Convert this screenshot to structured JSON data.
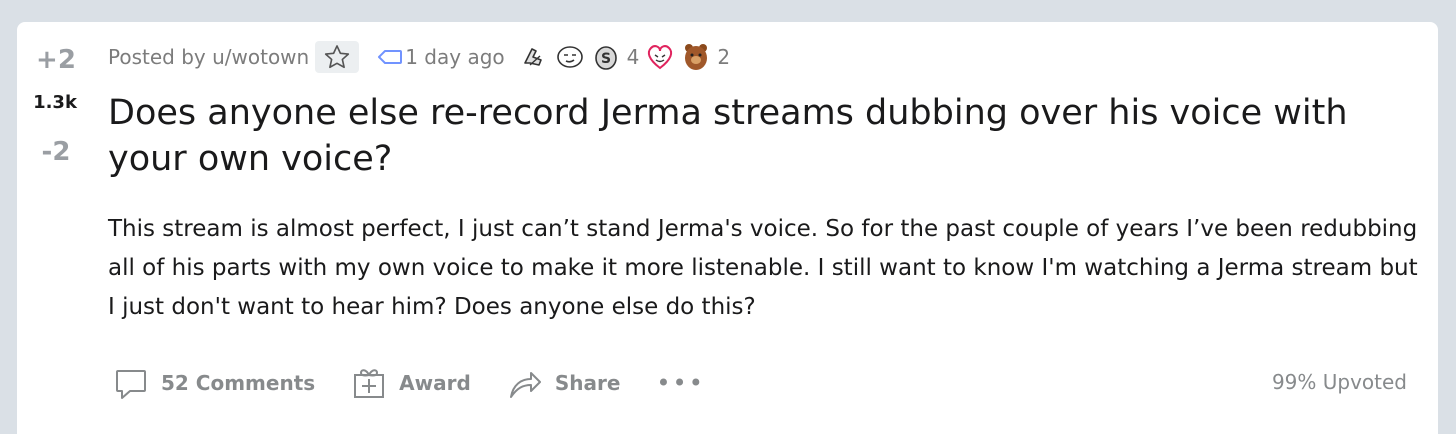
{
  "vote": {
    "up_label": "+2",
    "score": "1.3k",
    "down_label": "-2"
  },
  "meta": {
    "posted_by": "Posted by u/wotown",
    "time": "1 day ago",
    "awards": [
      {
        "icon": "hands-award-icon",
        "count": ""
      },
      {
        "icon": "face-award-icon",
        "count": ""
      },
      {
        "icon": "silver-award-icon",
        "count": "4"
      },
      {
        "icon": "heart-eyes-award-icon",
        "count": ""
      },
      {
        "icon": "bear-award-icon",
        "count": "2"
      }
    ]
  },
  "title": "Does anyone else re-record Jerma streams dubbing over his voice with your own voice?",
  "body": "This stream is almost perfect, I just can’t stand Jerma's voice. So for the past couple of years I’ve been redubbing all of his parts with my own voice to make it more listenable. I still want to know I'm watching a Jerma stream but I just don't want to hear him? Does anyone else do this?",
  "actions": {
    "comments": "52 Comments",
    "award": "Award",
    "share": "Share",
    "more": "•••"
  },
  "upvoted": "99% Upvoted",
  "colors": {
    "background": "#dae0e6",
    "card": "#ffffff",
    "muted": "#878a8c",
    "text": "#1a1a1b"
  }
}
